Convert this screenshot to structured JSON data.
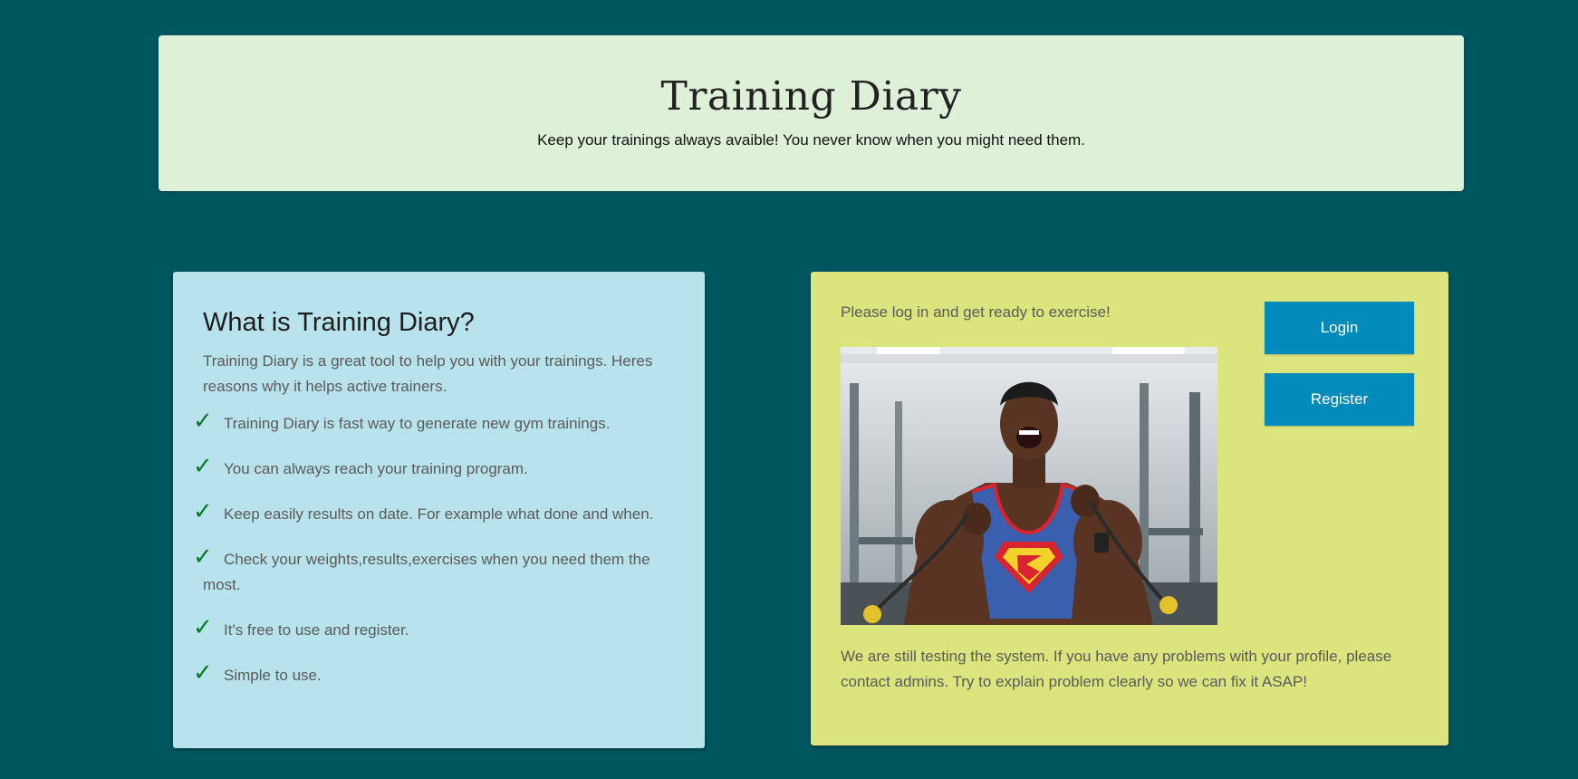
{
  "header": {
    "title": "Training Diary",
    "subtitle": "Keep your trainings always avaible! You never know when you might need them."
  },
  "about": {
    "heading": "What is Training Diary?",
    "intro": "Training Diary is a great tool to help you with your trainings. Heres reasons why it helps active trainers.",
    "check_icon": "✓",
    "benefits": [
      "Training Diary is fast way to generate new gym trainings.",
      "You can always reach your training program.",
      "Keep easily results on date. For example what done and when.",
      "Check your weights,results,exercises when you need them the most.",
      "It's free to use and register.",
      "Simple to use."
    ]
  },
  "auth": {
    "prompt": "Please log in and get ready to exercise!",
    "login_label": "Login",
    "register_label": "Register",
    "notice": "We are still testing the system. If you have any problems with your profile, please contact admins. Try to explain problem clearly so we can fix it ASAP!"
  },
  "colors": {
    "background": "#00565f",
    "header_bg": "#dff0d8",
    "about_bg": "#b8e3ec",
    "auth_bg": "#dce57d",
    "button_bg": "#008bbb",
    "check_color": "#0a7a2a"
  }
}
